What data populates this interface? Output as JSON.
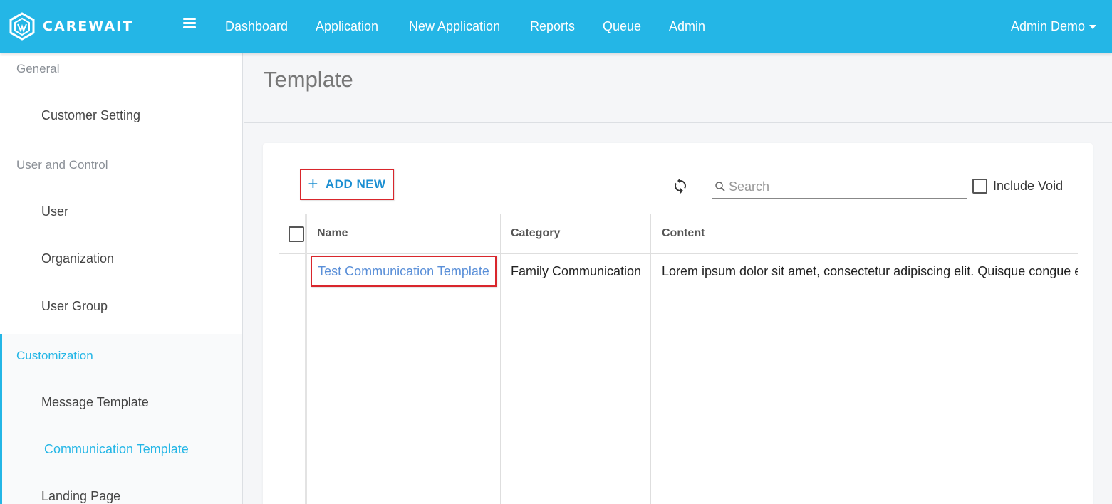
{
  "app": {
    "brand_name": "CAREWAIT",
    "brand_color": "#24b6e6",
    "accent_red": "#d9262c"
  },
  "nav": {
    "items": [
      {
        "label": "Dashboard"
      },
      {
        "label": "Application"
      },
      {
        "label": "New Application"
      },
      {
        "label": "Reports"
      },
      {
        "label": "Queue"
      },
      {
        "label": "Admin"
      }
    ],
    "user_label": "Admin Demo",
    "menu_icon": "hamburger-icon",
    "user_icon": "caret-down-icon"
  },
  "sidebar": {
    "sections": [
      {
        "label": "General",
        "items": [
          {
            "label": "Customer Setting"
          }
        ]
      },
      {
        "label": "User and Control",
        "items": [
          {
            "label": "User"
          },
          {
            "label": "Organization"
          },
          {
            "label": "User Group"
          }
        ]
      },
      {
        "label": "Customization",
        "active": true,
        "items": [
          {
            "label": "Message Template"
          },
          {
            "label": "Communication Template",
            "active": true
          },
          {
            "label": "Landing Page"
          }
        ]
      }
    ]
  },
  "page": {
    "title": "Template"
  },
  "toolbar": {
    "add_new_label": "ADD NEW",
    "add_icon": "plus-icon",
    "refresh_icon": "refresh-icon",
    "search_placeholder": "Search",
    "search_value": "",
    "include_void_label": "Include Void",
    "include_void_checked": false
  },
  "table": {
    "columns": [
      "Name",
      "Category",
      "Content"
    ],
    "rows": [
      {
        "name": "Test Communication Template",
        "category": "Family Communication",
        "content": "Lorem ipsum dolor sit amet, consectetur adipiscing elit. Quisque congue e"
      }
    ]
  }
}
